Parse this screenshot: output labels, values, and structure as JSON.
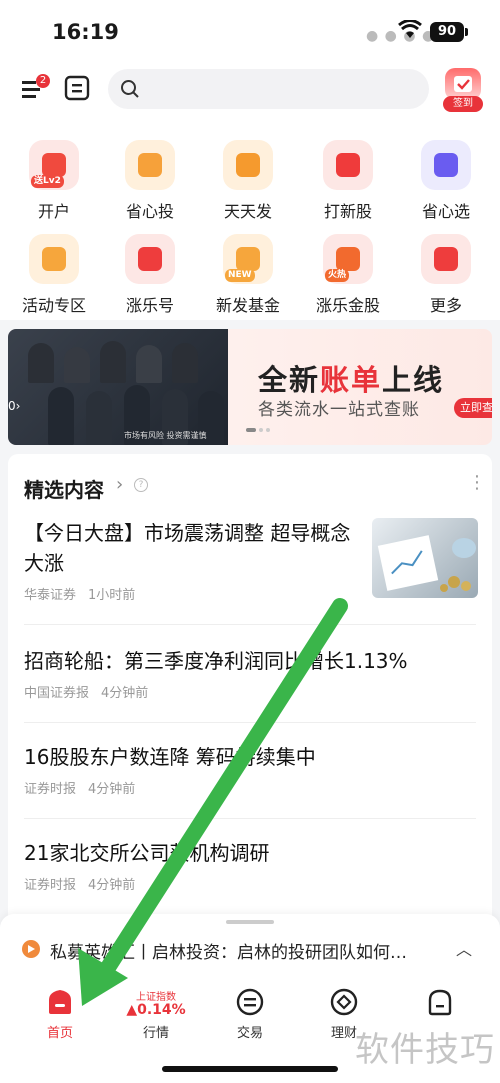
{
  "status_bar": {
    "time": "16:19",
    "battery": "90"
  },
  "top_bar": {
    "menu_badge": "2",
    "signin_label": "签到"
  },
  "grid": [
    {
      "label": "开户",
      "icon": "account-open-icon",
      "color": "#f04a3e",
      "badge": "送Lv2"
    },
    {
      "label": "省心投",
      "icon": "heart-invest-icon",
      "color": "#f6a13a"
    },
    {
      "label": "天天发",
      "icon": "trend-up-icon",
      "color": "#f59a2e"
    },
    {
      "label": "打新股",
      "icon": "new-stock-icon",
      "color": "#ef3b3b"
    },
    {
      "label": "省心选",
      "icon": "star-icon",
      "color": "#6a5cf0"
    },
    {
      "label": "活动专区",
      "icon": "balloon-icon",
      "color": "#f6a63c"
    },
    {
      "label": "涨乐号",
      "icon": "rise-icon",
      "color": "#ee3d3d"
    },
    {
      "label": "新发基金",
      "icon": "new-fund-icon",
      "color": "#f6a63c",
      "badge": "NEW"
    },
    {
      "label": "涨乐金股",
      "icon": "hot-stock-icon",
      "color": "#f26a2e",
      "badge": "火热"
    },
    {
      "label": "更多",
      "icon": "more-grid-icon",
      "color": "#ee3d3d"
    }
  ],
  "banner": {
    "headline_pre": "全新",
    "headline_hl": "账单",
    "headline_post": "上线",
    "subtitle": "各类流水一站式查账",
    "button": "立即查看",
    "risk_note": "市场有风险 投资需谨慎",
    "left_chip": "0›"
  },
  "content": {
    "title": "精选内容",
    "news": [
      {
        "title": "【今日大盘】市场震荡调整 超导概念大涨",
        "source": "华泰证券",
        "time": "1小时前"
      },
      {
        "title": "招商轮船：第三季度净利润同比增长1.13%",
        "source": "中国证券报",
        "time": "4分钟前"
      },
      {
        "title": "16股股东户数连降 筹码持续集中",
        "source": "证券时报",
        "time": "4分钟前"
      },
      {
        "title": "21家北交所公司获机构调研",
        "source": "证券时报",
        "time": "4分钟前"
      }
    ]
  },
  "ticker": {
    "text": "私募英雄汇丨启林投资：启林的投研团队如何…"
  },
  "bottom_nav": {
    "home": "首页",
    "market": "行情",
    "index_name": "上证指数",
    "index_value": "▲0.14%",
    "trade": "交易",
    "wealth": "理财"
  },
  "watermark": "软件技巧",
  "colors": {
    "brand_red": "#e8333a",
    "arrow_green": "#3ab54a"
  }
}
